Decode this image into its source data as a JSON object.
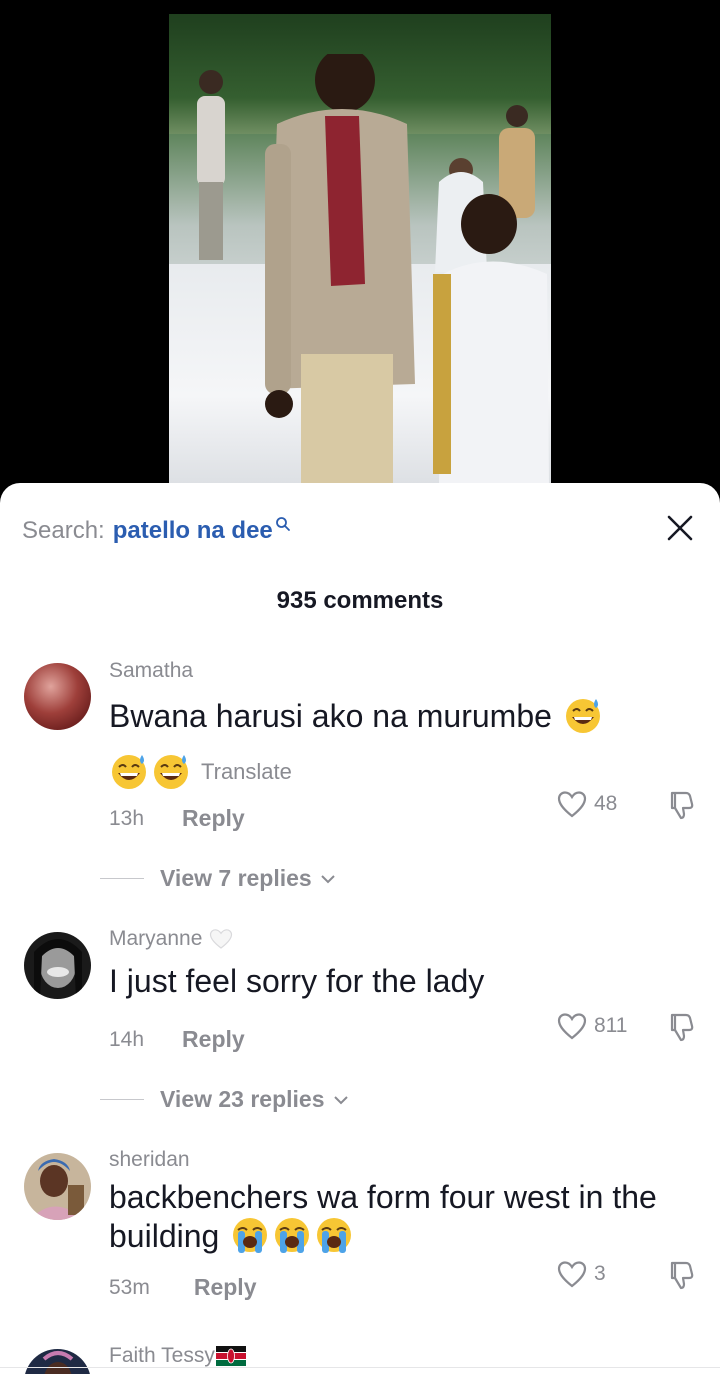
{
  "search": {
    "label": "Search:",
    "term": "patello na dee"
  },
  "comments_header": {
    "count_text": "935 comments"
  },
  "comments": [
    {
      "username": "Samatha",
      "text": "Bwana harusi ako na murumbe",
      "emoji": [
        "sweat-smile-emoji",
        "sweat-smile-emoji",
        "sweat-smile-emoji"
      ],
      "translate": "Translate",
      "time": "13h",
      "reply": "Reply",
      "likes": "48",
      "view_replies": "View 7 replies"
    },
    {
      "username": "Maryanne",
      "text": "I just feel sorry for the lady",
      "time": "14h",
      "reply": "Reply",
      "likes": "811",
      "view_replies": "View 23 replies"
    },
    {
      "username": "sheridan",
      "text": "backbenchers wa form four west in the building",
      "emoji": [
        "loudly-crying-emoji",
        "loudly-crying-emoji",
        "loudly-crying-emoji"
      ],
      "time": "53m",
      "reply": "Reply",
      "likes": "3"
    },
    {
      "username": "Faith Tessy",
      "flag": "kenya-flag-icon"
    }
  ],
  "colors": {
    "link_blue": "#2b5db0",
    "muted_gray": "#8a8b91",
    "text_dark": "#161823"
  }
}
